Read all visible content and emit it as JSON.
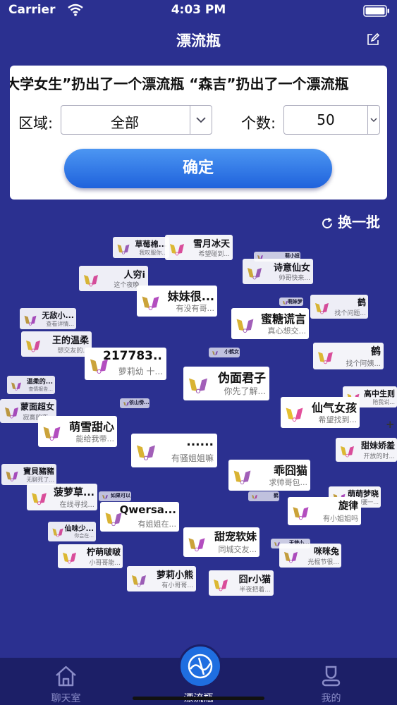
{
  "status_bar": {
    "carrier": "Carrier",
    "time": "4:03 PM"
  },
  "nav": {
    "title": "漂流瓶",
    "edit_icon": "edit-icon"
  },
  "panel": {
    "marquee": "瓶 “大学女生”扔出了一个漂流瓶 “森吉”扔出了一个漂流瓶",
    "region_label": "区域:",
    "region_value": "全部",
    "count_label": "个数:",
    "count_value": "50",
    "confirm": "确定"
  },
  "refresh_label": "换一批",
  "bottles": [
    {
      "name": "草莓棉...",
      "sub": "我叹服你..."
    },
    {
      "name": "雪月冰天",
      "sub": "希望碰到..."
    },
    {
      "name": "萌小妞",
      "sub": ""
    },
    {
      "name": "诗意仙女",
      "sub": "帅哥快来..."
    },
    {
      "name": "人穷i",
      "sub": "这个夜晚..."
    },
    {
      "name": "妹妹很...",
      "sub": "有没有哥..."
    },
    {
      "name": "萌妹梦...",
      "sub": ""
    },
    {
      "name": "鹤",
      "sub": "找个问题..."
    },
    {
      "name": "无敌小...",
      "sub": "查看详情..."
    },
    {
      "name": "蜜糖谎言",
      "sub": "真心想交..."
    },
    {
      "name": "王的温柔",
      "sub": "想交友的..."
    },
    {
      "name": "217783...",
      "sub": "萝莉幼 十..."
    },
    {
      "name": "小鹤女",
      "sub": ""
    },
    {
      "name": "鹤",
      "sub": "找个阿姨..."
    },
    {
      "name": "温柔的...",
      "sub": "查情报告..."
    },
    {
      "name": "伪面君子",
      "sub": "你先了解..."
    },
    {
      "name": "高中生则",
      "sub": "陪我说..."
    },
    {
      "name": "蒙面超女",
      "sub": "寂寞的夜..."
    },
    {
      "name": "依山傍...",
      "sub": ""
    },
    {
      "name": "仙气女孩",
      "sub": "希望找到..."
    },
    {
      "name": "萌雪甜心",
      "sub": "能给我带..."
    },
    {
      "name": "......",
      "sub": "有骚姐姐嘛"
    },
    {
      "name": "甜妹娇羞",
      "sub": "开放的时..."
    },
    {
      "name": "寶貝豬豬",
      "sub": "无聊死了..."
    },
    {
      "name": "乖囧猫",
      "sub": "求帅哥包..."
    },
    {
      "name": "菠萝草...",
      "sub": "在线寻找..."
    },
    {
      "name": "萌萌梦晓",
      "sub": "我想要一..."
    },
    {
      "name": "如果可以",
      "sub": ""
    },
    {
      "name": "鹤",
      "sub": ""
    },
    {
      "name": "旋律",
      "sub": "有小姐姐吗"
    },
    {
      "name": "Qwersa...",
      "sub": "有姐姐在..."
    },
    {
      "name": "仙味少...",
      "sub": "你会在..."
    },
    {
      "name": "甜宠软妹",
      "sub": "同城交友..."
    },
    {
      "name": "天使小...",
      "sub": ""
    },
    {
      "name": "柠萌啵啵",
      "sub": "小哥哥能..."
    },
    {
      "name": "咪咪兔",
      "sub": "光棍节很..."
    },
    {
      "name": "萝莉小熊",
      "sub": "有小哥哥..."
    },
    {
      "name": "囧r小猫",
      "sub": "半夜把着..."
    }
  ],
  "tabs": [
    {
      "label": "聊天室",
      "icon": "home-icon"
    },
    {
      "label": "漂流瓶",
      "icon": "bottle-icon"
    },
    {
      "label": "我的",
      "icon": "user-icon"
    }
  ]
}
